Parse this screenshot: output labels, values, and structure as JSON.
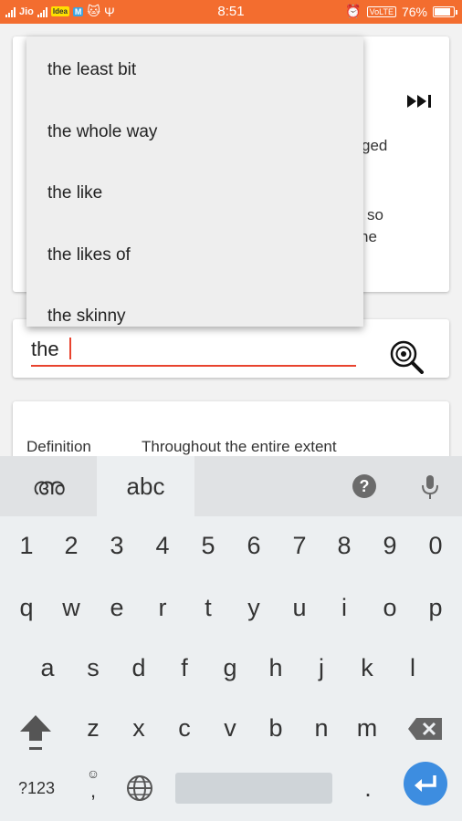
{
  "status_bar": {
    "carrier_1": "Jio",
    "carrier_2": "Idea",
    "time": "8:51",
    "volte": "VoLTE",
    "battery_percent": "76%",
    "battery_level": 0.76
  },
  "background_card": {
    "fragment_1": "ged",
    "fragment_2": "so",
    "fragment_3": "ne"
  },
  "suggestions": [
    "the least bit",
    "the whole way",
    "the like",
    "the likes of",
    "the skinny"
  ],
  "search": {
    "value": "the"
  },
  "definition": {
    "label": "Definition",
    "value": "Throughout the entire extent"
  },
  "keyboard": {
    "tab_malayalam": "അ",
    "tab_abc": "abc",
    "help": "?",
    "row_numbers": [
      "1",
      "2",
      "3",
      "4",
      "5",
      "6",
      "7",
      "8",
      "9",
      "0"
    ],
    "row_1": [
      "q",
      "w",
      "e",
      "r",
      "t",
      "y",
      "u",
      "i",
      "o",
      "p"
    ],
    "row_2": [
      "a",
      "s",
      "d",
      "f",
      "g",
      "h",
      "j",
      "k",
      "l"
    ],
    "row_3": [
      "z",
      "x",
      "c",
      "v",
      "b",
      "n",
      "m"
    ],
    "symbols_key": "?123",
    "comma_key": ",",
    "period_key": "."
  },
  "colors": {
    "status_bar": "#f36d2f",
    "input_underline": "#e8432e",
    "enter_button": "#3d8de0"
  }
}
